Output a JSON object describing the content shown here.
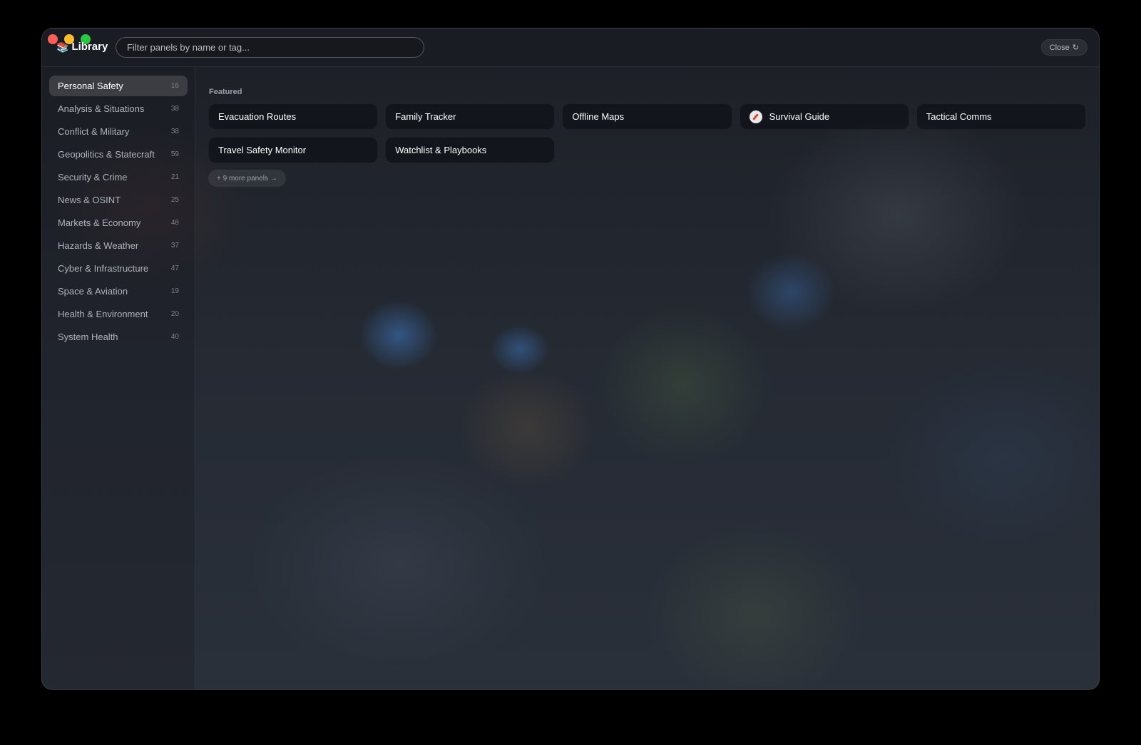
{
  "app": {
    "title": "Library",
    "brand_icon": "books-icon"
  },
  "search": {
    "placeholder": "Filter panels by name or tag...",
    "value": ""
  },
  "header": {
    "close_label": "Close",
    "close_icon": "↻"
  },
  "sidebar": {
    "active_index": 0,
    "items": [
      {
        "label": "Personal Safety",
        "count": "16"
      },
      {
        "label": "Analysis & Situations",
        "count": "38"
      },
      {
        "label": "Conflict & Military",
        "count": "38"
      },
      {
        "label": "Geopolitics & Statecraft",
        "count": "59"
      },
      {
        "label": "Security & Crime",
        "count": "21"
      },
      {
        "label": "News & OSINT",
        "count": "25"
      },
      {
        "label": "Markets & Economy",
        "count": "48"
      },
      {
        "label": "Hazards & Weather",
        "count": "37"
      },
      {
        "label": "Cyber & Infrastructure",
        "count": "47"
      },
      {
        "label": "Space & Aviation",
        "count": "19"
      },
      {
        "label": "Health & Environment",
        "count": "20"
      },
      {
        "label": "System Health",
        "count": "40"
      }
    ]
  },
  "main": {
    "section_label": "Featured",
    "cards": [
      {
        "label": "Evacuation Routes",
        "icon": ""
      },
      {
        "label": "Family Tracker",
        "icon": ""
      },
      {
        "label": "Offline Maps",
        "icon": ""
      },
      {
        "label": "Survival Guide",
        "icon": "compass-icon"
      },
      {
        "label": "Tactical Comms",
        "icon": ""
      },
      {
        "label": "Travel Safety Monitor",
        "icon": ""
      },
      {
        "label": "Watchlist & Playbooks",
        "icon": ""
      }
    ],
    "more_label": "+ 9 more panels →"
  },
  "colors": {
    "close_red": "#ff5f57",
    "minimize_yellow": "#febc2e",
    "zoom_green": "#28c840"
  }
}
